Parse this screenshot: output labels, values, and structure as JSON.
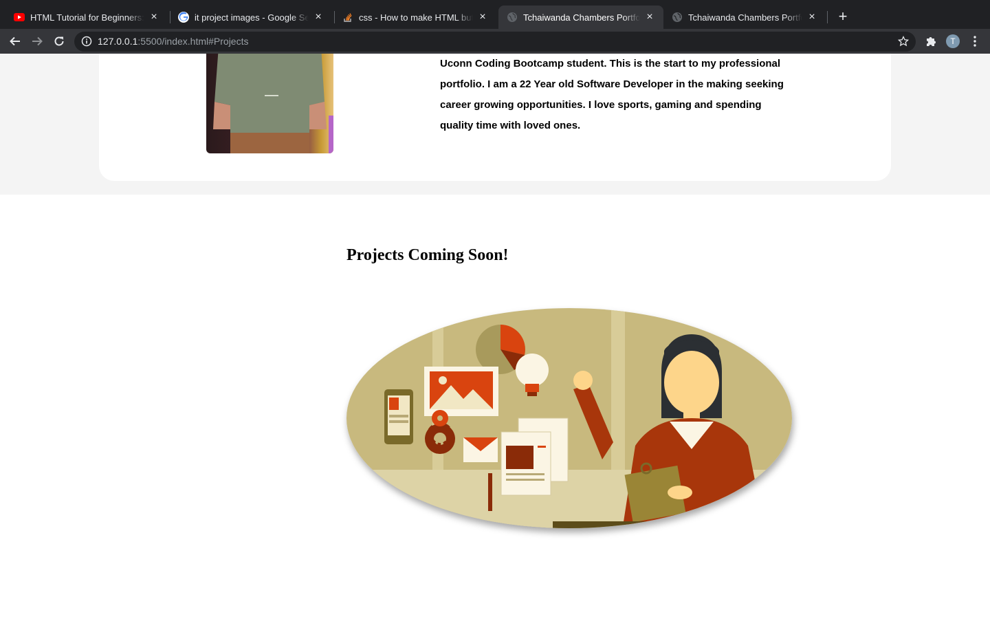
{
  "browser": {
    "tabs": [
      {
        "title": "HTML Tutorial for Beginners: HTML Crash Course",
        "icon": "youtube-icon"
      },
      {
        "title": "it project images - Google Search",
        "icon": "google-icon"
      },
      {
        "title": "css - How to make HTML button",
        "icon": "stackoverflow-icon"
      },
      {
        "title": "Tchaiwanda Chambers Portfolio",
        "icon": "globe-icon",
        "active": true
      },
      {
        "title": "Tchaiwanda Chambers Portfolio",
        "icon": "globe-icon"
      }
    ],
    "url_host": "127.0.0.1",
    "url_rest": ":5500/index.html#Projects",
    "profile_initial": "T"
  },
  "about": {
    "text": "My name is Tchaiwanda Chambers. I am from New Haven, CT. I am a Uconn Coding Bootcamp student. This is the start to my professional portfolio. I am a 22 Year old Software Developer in the making seeking career growing opportunities. I love sports, gaming and spending quality time with loved ones."
  },
  "projects": {
    "title": "Projects Coming Soon!"
  },
  "colors": {
    "chrome_dark": "#202124",
    "chrome_toolbar": "#35363a",
    "section_band": "#f4f4f4",
    "illustration_bg": "#c8b97e",
    "illustration_accent": "#d9440f"
  }
}
